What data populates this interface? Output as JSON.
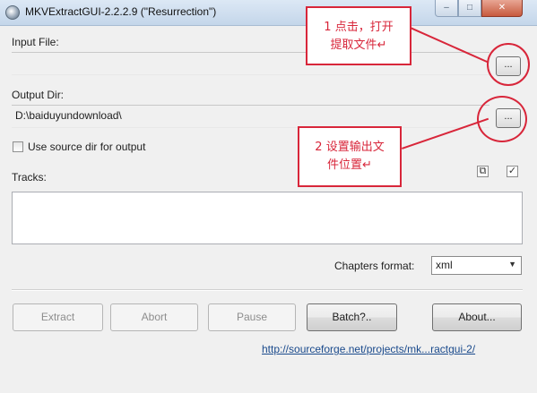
{
  "window": {
    "title": "MKVExtractGUI-2.2.2.9 (\"Resurrection\")",
    "minimize_glyph": "–",
    "maximize_glyph": "□",
    "close_glyph": "✕"
  },
  "input_file": {
    "label": "Input File:",
    "value": "",
    "browse_label": "..."
  },
  "output_dir": {
    "label": "Output Dir:",
    "value": "D:\\baiduyundownload\\",
    "browse_label": "..."
  },
  "use_source": {
    "label": "Use source dir for output",
    "checked": false
  },
  "tracks": {
    "label": "Tracks:",
    "select_all_icon": "✓",
    "copy_icon": "⧉"
  },
  "chapters": {
    "label": "Chapters format:",
    "selected": "xml",
    "arrow": "▼"
  },
  "buttons": {
    "extract": "Extract",
    "abort": "Abort",
    "pause": "Pause",
    "batch": "Batch?..",
    "about": "About..."
  },
  "link": "http://sourceforge.net/projects/mk...ractgui-2/",
  "annotations": {
    "step1_line1": "1 点击，打开",
    "step1_line2": "提取文件↵",
    "step2_line1": "2 设置输出文",
    "step2_line2": "件位置↵",
    "color": "#d8263a"
  }
}
